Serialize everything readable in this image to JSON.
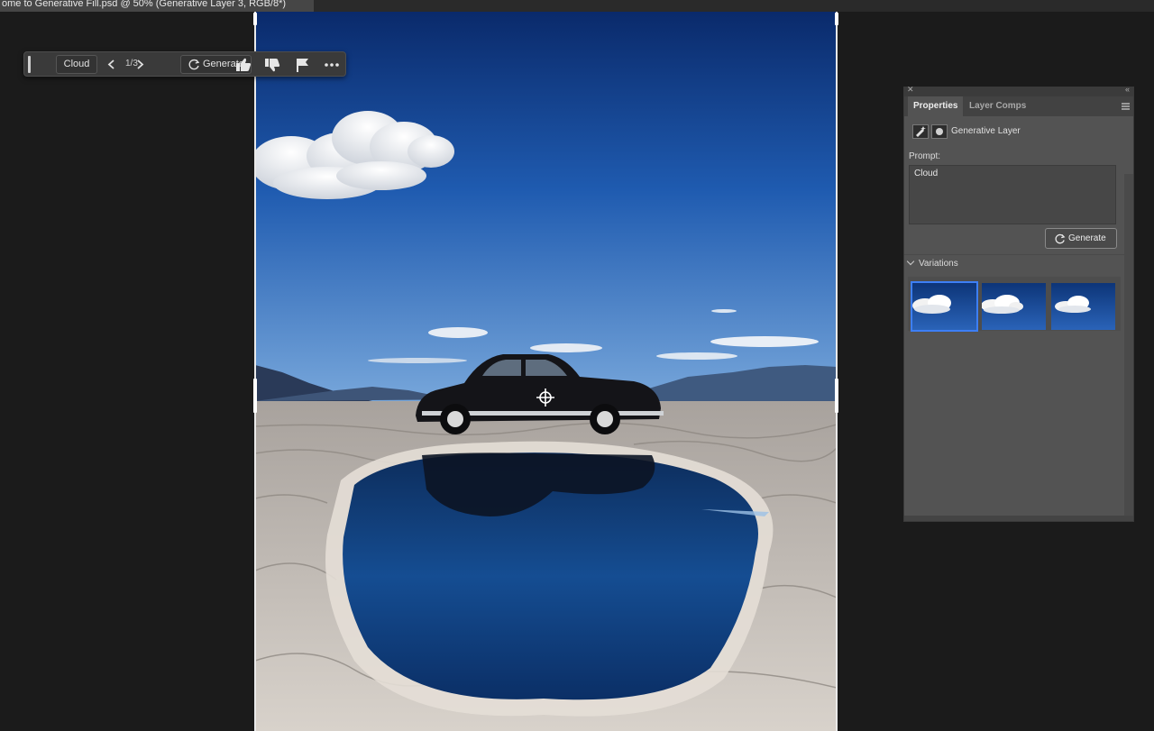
{
  "document": {
    "tab_title": "ome to Generative Fill.psd @ 50% (Generative Layer 3, RGB/8*)"
  },
  "taskbar": {
    "prompt_label": "Cloud",
    "variation_counter": "1/3",
    "generate_label": "Generate"
  },
  "properties_panel": {
    "tabs": [
      {
        "label": "Properties",
        "active": true
      },
      {
        "label": "Layer Comps",
        "active": false
      }
    ],
    "layer_type_label": "Generative Layer",
    "prompt_heading": "Prompt:",
    "prompt_value": "Cloud",
    "generate_label": "Generate",
    "variations_heading": "Variations",
    "variations_selected_index": 0
  },
  "colors": {
    "app_background": "#1b1b1b",
    "panel_background": "#535353",
    "selection_accent": "#3d7ff6",
    "sky_top": "#0a2a6b",
    "sky_bottom": "#6f9fd6"
  },
  "icons": {
    "prev": "chevron-left-icon",
    "next": "chevron-right-icon",
    "generate": "refresh-icon",
    "thumbs_up": "thumbs-up-icon",
    "thumbs_down": "thumbs-down-icon",
    "report": "flag-icon",
    "more": "more-icon"
  }
}
